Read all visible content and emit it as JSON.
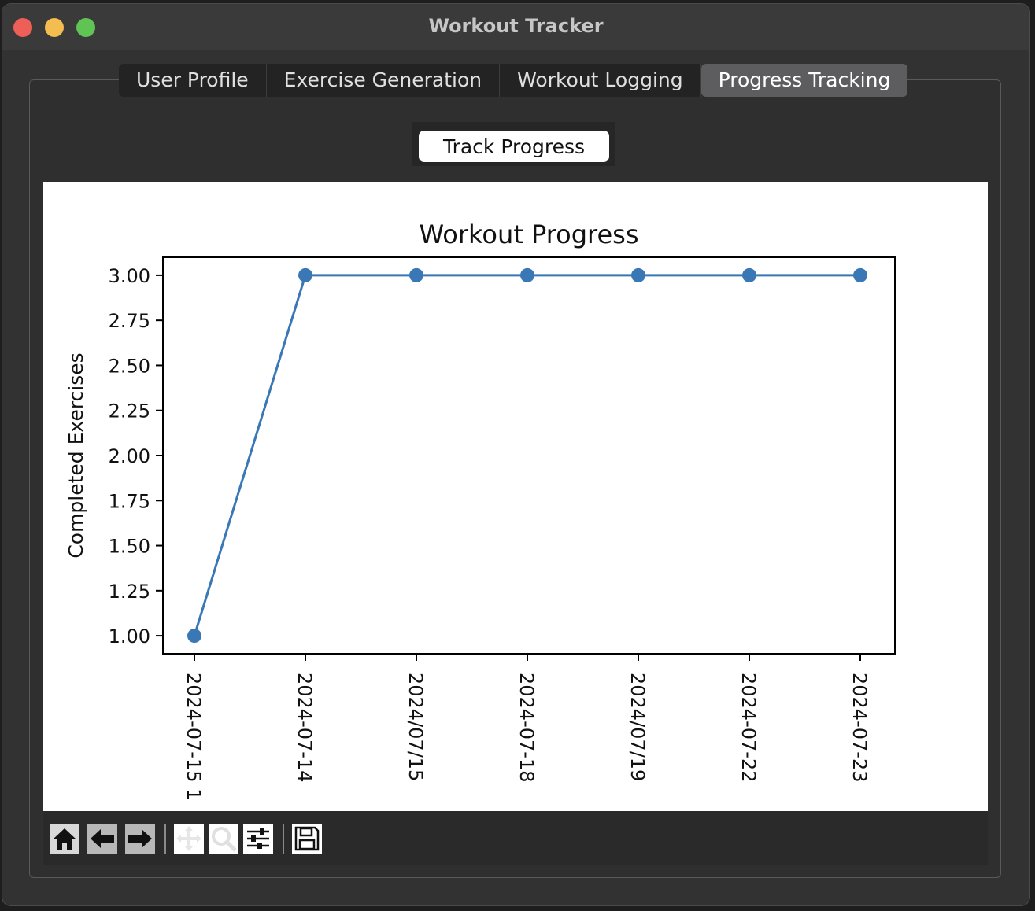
{
  "window": {
    "title": "Workout Tracker"
  },
  "tabs": [
    {
      "label": "User Profile",
      "active": false
    },
    {
      "label": "Exercise Generation",
      "active": false
    },
    {
      "label": "Workout Logging",
      "active": false
    },
    {
      "label": "Progress Tracking",
      "active": true
    }
  ],
  "track_button": {
    "label": "Track Progress"
  },
  "toolbar": {
    "icons": [
      "home-icon",
      "back-icon",
      "forward-icon",
      "pan-icon",
      "zoom-icon",
      "configure-subplots-icon",
      "save-icon"
    ]
  },
  "chart_data": {
    "type": "line",
    "title": "Workout Progress",
    "xlabel": "",
    "ylabel": "Completed Exercises",
    "categories": [
      "2024-07-15 1",
      "2024-07-14",
      "2024/07/15",
      "2024-07-18",
      "2024/07/19",
      "2024-07-22",
      "2024-07-23"
    ],
    "values": [
      1,
      3,
      3,
      3,
      3,
      3,
      3
    ],
    "yticks": [
      "1.00",
      "1.25",
      "1.50",
      "1.75",
      "2.00",
      "2.25",
      "2.50",
      "2.75",
      "3.00"
    ],
    "ylim": [
      0.9,
      3.1
    ],
    "markers": true,
    "grid": false,
    "color": "#3a77b5"
  }
}
